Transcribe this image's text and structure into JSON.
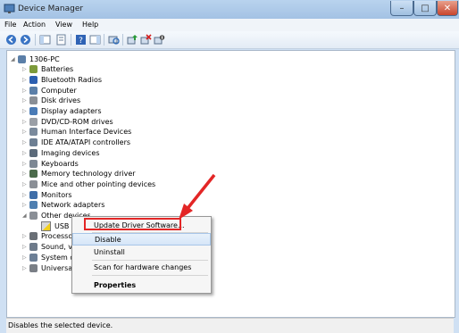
{
  "window": {
    "title": "Device Manager",
    "controls": {
      "minimize": "–",
      "maximize": "□",
      "close": "✕"
    }
  },
  "menu": [
    "File",
    "Action",
    "View",
    "Help"
  ],
  "tree": [
    {
      "label": "1306-PC",
      "icon": "computer-icon",
      "level": 0,
      "expanded": true
    },
    {
      "label": "Batteries",
      "icon": "battery-icon",
      "level": 1
    },
    {
      "label": "Bluetooth Radios",
      "icon": "bluetooth-icon",
      "level": 1
    },
    {
      "label": "Computer",
      "icon": "computer-icon",
      "level": 1
    },
    {
      "label": "Disk drives",
      "icon": "disk-icon",
      "level": 1
    },
    {
      "label": "Display adapters",
      "icon": "display-icon",
      "level": 1
    },
    {
      "label": "DVD/CD-ROM drives",
      "icon": "dvd-icon",
      "level": 1
    },
    {
      "label": "Human Interface Devices",
      "icon": "hid-icon",
      "level": 1
    },
    {
      "label": "IDE ATA/ATAPI controllers",
      "icon": "ide-icon",
      "level": 1
    },
    {
      "label": "Imaging devices",
      "icon": "camera-icon",
      "level": 1
    },
    {
      "label": "Keyboards",
      "icon": "keyboard-icon",
      "level": 1
    },
    {
      "label": "Memory technology driver",
      "icon": "memory-icon",
      "level": 1
    },
    {
      "label": "Mice and other pointing devices",
      "icon": "mouse-icon",
      "level": 1
    },
    {
      "label": "Monitors",
      "icon": "monitor-icon",
      "level": 1
    },
    {
      "label": "Network adapters",
      "icon": "network-icon",
      "level": 1
    },
    {
      "label": "Other devices",
      "icon": "other-devices-icon",
      "level": 1,
      "expanded": true
    },
    {
      "label": "USB Se",
      "icon": "warning-device-icon",
      "level": 2
    },
    {
      "label": "Processor",
      "icon": "processor-icon",
      "level": 1
    },
    {
      "label": "Sound, vi",
      "icon": "sound-icon",
      "level": 1
    },
    {
      "label": "System de",
      "icon": "system-icon",
      "level": 1
    },
    {
      "label": "Universal",
      "icon": "usb-icon",
      "level": 1
    }
  ],
  "context_menu": {
    "items": [
      "Update Driver Software...",
      "Disable",
      "Uninstall",
      "Scan for hardware changes",
      "Properties"
    ],
    "hovered": "Disable"
  },
  "status": "Disables the selected device.",
  "colors": {
    "annotation": "#e32626",
    "title_bar": "#a3c2e4"
  }
}
